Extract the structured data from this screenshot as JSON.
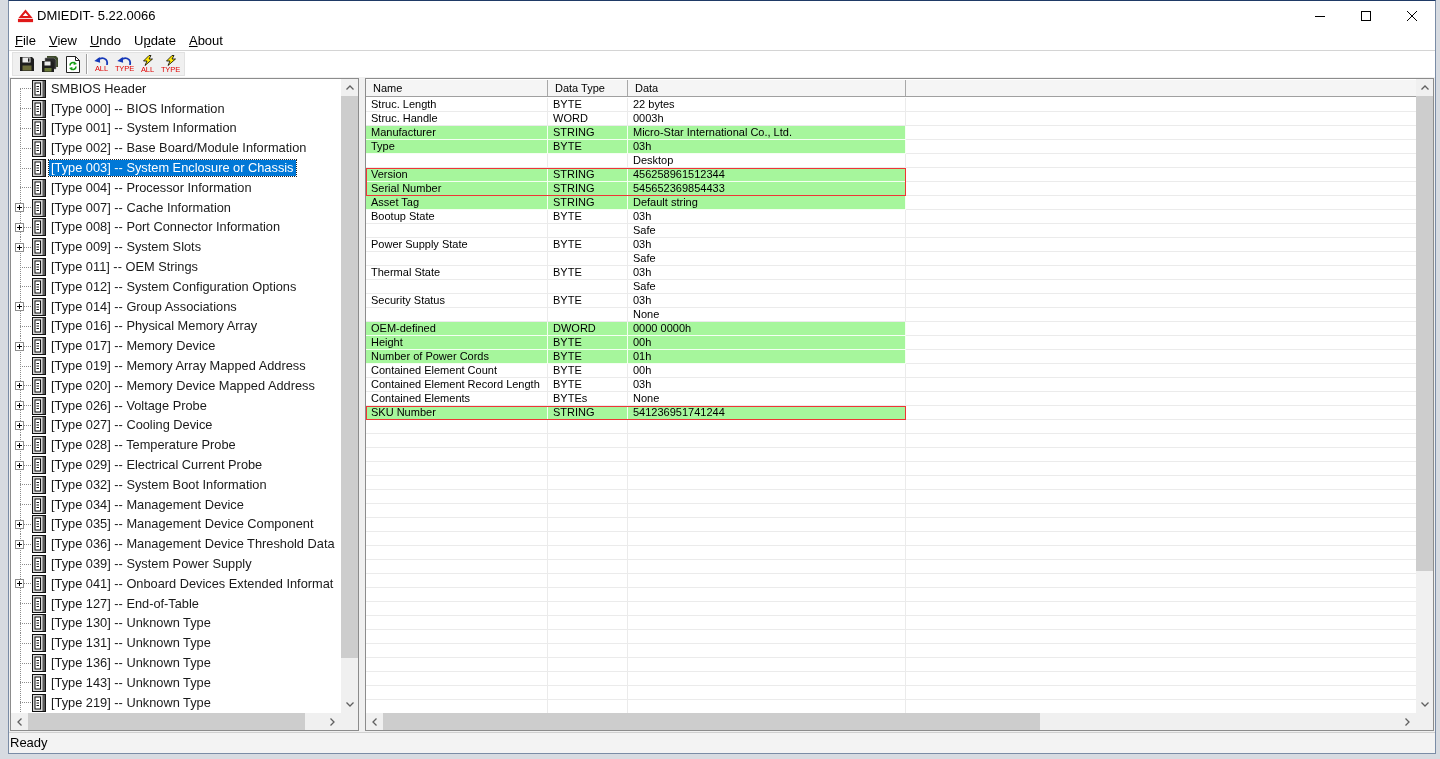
{
  "window": {
    "title": "DMIEDIT- 5.22.0066"
  },
  "menu": [
    {
      "key": "F",
      "post": "ile"
    },
    {
      "key": "V",
      "post": "iew"
    },
    {
      "key": "U",
      "post": "ndo"
    },
    {
      "pre": "U",
      "key": "p",
      "post": "date"
    },
    {
      "key": "A",
      "post": "bout"
    }
  ],
  "toolbar": [
    {
      "kind": "save"
    },
    {
      "kind": "save_all"
    },
    {
      "kind": "reload"
    },
    {
      "kind": "separator"
    },
    {
      "kind": "undo",
      "label": "ALL"
    },
    {
      "kind": "undo",
      "label": "TYPE"
    },
    {
      "kind": "update",
      "label": "ALL"
    },
    {
      "kind": "update",
      "label": "TYPE"
    }
  ],
  "tree": {
    "items": [
      {
        "label": "SMBIOS Header",
        "expandable": false,
        "selected": false
      },
      {
        "label": "[Type 000] -- BIOS Information",
        "expandable": false,
        "selected": false
      },
      {
        "label": "[Type 001] -- System Information",
        "expandable": false,
        "selected": false
      },
      {
        "label": "[Type 002] -- Base Board/Module Information",
        "expandable": false,
        "selected": false
      },
      {
        "label": "[Type 003] -- System Enclosure or Chassis",
        "expandable": false,
        "selected": true
      },
      {
        "label": "[Type 004] -- Processor Information",
        "expandable": false,
        "selected": false
      },
      {
        "label": "[Type 007] -- Cache Information",
        "expandable": true,
        "selected": false
      },
      {
        "label": "[Type 008] -- Port Connector Information",
        "expandable": true,
        "selected": false
      },
      {
        "label": "[Type 009] -- System Slots",
        "expandable": true,
        "selected": false
      },
      {
        "label": "[Type 011] -- OEM Strings",
        "expandable": false,
        "selected": false
      },
      {
        "label": "[Type 012] -- System Configuration Options",
        "expandable": false,
        "selected": false
      },
      {
        "label": "[Type 014] -- Group Associations",
        "expandable": true,
        "selected": false
      },
      {
        "label": "[Type 016] -- Physical Memory Array",
        "expandable": false,
        "selected": false
      },
      {
        "label": "[Type 017] -- Memory Device",
        "expandable": true,
        "selected": false
      },
      {
        "label": "[Type 019] -- Memory Array Mapped Address",
        "expandable": false,
        "selected": false
      },
      {
        "label": "[Type 020] -- Memory Device Mapped Address",
        "expandable": true,
        "selected": false
      },
      {
        "label": "[Type 026] -- Voltage Probe",
        "expandable": true,
        "selected": false
      },
      {
        "label": "[Type 027] -- Cooling Device",
        "expandable": true,
        "selected": false
      },
      {
        "label": "[Type 028] -- Temperature Probe",
        "expandable": true,
        "selected": false
      },
      {
        "label": "[Type 029] -- Electrical Current Probe",
        "expandable": true,
        "selected": false
      },
      {
        "label": "[Type 032] -- System Boot Information",
        "expandable": false,
        "selected": false
      },
      {
        "label": "[Type 034] -- Management Device",
        "expandable": false,
        "selected": false
      },
      {
        "label": "[Type 035] -- Management Device Component",
        "expandable": true,
        "selected": false
      },
      {
        "label": "[Type 036] -- Management Device Threshold Data",
        "expandable": true,
        "selected": false
      },
      {
        "label": "[Type 039] -- System Power Supply",
        "expandable": false,
        "selected": false
      },
      {
        "label": "[Type 041] -- Onboard Devices Extended Informat",
        "expandable": true,
        "selected": false
      },
      {
        "label": "[Type 127] -- End-of-Table",
        "expandable": false,
        "selected": false
      },
      {
        "label": "[Type 130] -- Unknown Type",
        "expandable": false,
        "selected": false
      },
      {
        "label": "[Type 131] -- Unknown Type",
        "expandable": false,
        "selected": false
      },
      {
        "label": "[Type 136] -- Unknown Type",
        "expandable": false,
        "selected": false
      },
      {
        "label": "[Type 143] -- Unknown Type",
        "expandable": false,
        "selected": false
      },
      {
        "label": "[Type 219] -- Unknown Type",
        "expandable": false,
        "selected": false
      }
    ]
  },
  "table": {
    "columns": [
      "Name",
      "Data Type",
      "Data"
    ],
    "rows": [
      {
        "name": "Struc. Length",
        "data_type": "BYTE",
        "data": "22 bytes",
        "highlighted": false,
        "outlined": false
      },
      {
        "name": "Struc. Handle",
        "data_type": "WORD",
        "data": "0003h",
        "highlighted": false,
        "outlined": false
      },
      {
        "name": "Manufacturer",
        "data_type": "STRING",
        "data": "Micro-Star International Co., Ltd.",
        "highlighted": true,
        "outlined": false
      },
      {
        "name": "Type",
        "data_type": "BYTE",
        "data": "03h",
        "highlighted": true,
        "outlined": false
      },
      {
        "data": "Desktop",
        "highlighted": false,
        "outlined": false
      },
      {
        "name": "Version",
        "data_type": "STRING",
        "data": "456258961512344",
        "highlighted": true,
        "outlined": true
      },
      {
        "name": "Serial Number",
        "data_type": "STRING",
        "data": "545652369854433",
        "highlighted": true,
        "outlined": true
      },
      {
        "name": "Asset Tag",
        "data_type": "STRING",
        "data": "Default string",
        "highlighted": true,
        "outlined": false
      },
      {
        "name": "Bootup State",
        "data_type": "BYTE",
        "data": "03h",
        "highlighted": false,
        "outlined": false
      },
      {
        "data": "Safe",
        "highlighted": false,
        "outlined": false
      },
      {
        "name": "Power Supply State",
        "data_type": "BYTE",
        "data": "03h",
        "highlighted": false,
        "outlined": false
      },
      {
        "data": "Safe",
        "highlighted": false,
        "outlined": false
      },
      {
        "name": "Thermal State",
        "data_type": "BYTE",
        "data": "03h",
        "highlighted": false,
        "outlined": false
      },
      {
        "data": "Safe",
        "highlighted": false,
        "outlined": false
      },
      {
        "name": "Security Status",
        "data_type": "BYTE",
        "data": "03h",
        "highlighted": false,
        "outlined": false
      },
      {
        "data": "None",
        "highlighted": false,
        "outlined": false
      },
      {
        "name": "OEM-defined",
        "data_type": "DWORD",
        "data": "0000 0000h",
        "highlighted": true,
        "outlined": false
      },
      {
        "name": "Height",
        "data_type": "BYTE",
        "data": "00h",
        "highlighted": true,
        "outlined": false
      },
      {
        "name": "Number of Power Cords",
        "data_type": "BYTE",
        "data": "01h",
        "highlighted": true,
        "outlined": false
      },
      {
        "name": "Contained Element Count",
        "data_type": "BYTE",
        "data": "00h",
        "highlighted": false,
        "outlined": false
      },
      {
        "name": "Contained Element Record Length",
        "data_type": "BYTE",
        "data": "03h",
        "highlighted": false,
        "outlined": false
      },
      {
        "name": "Contained Elements",
        "data_type": "BYTEs",
        "data": "None",
        "highlighted": false,
        "outlined": false
      },
      {
        "name": "SKU Number",
        "data_type": "STRING",
        "data": "541236951741244",
        "highlighted": true,
        "outlined": true
      }
    ]
  },
  "status_bar": {
    "text": "Ready"
  }
}
